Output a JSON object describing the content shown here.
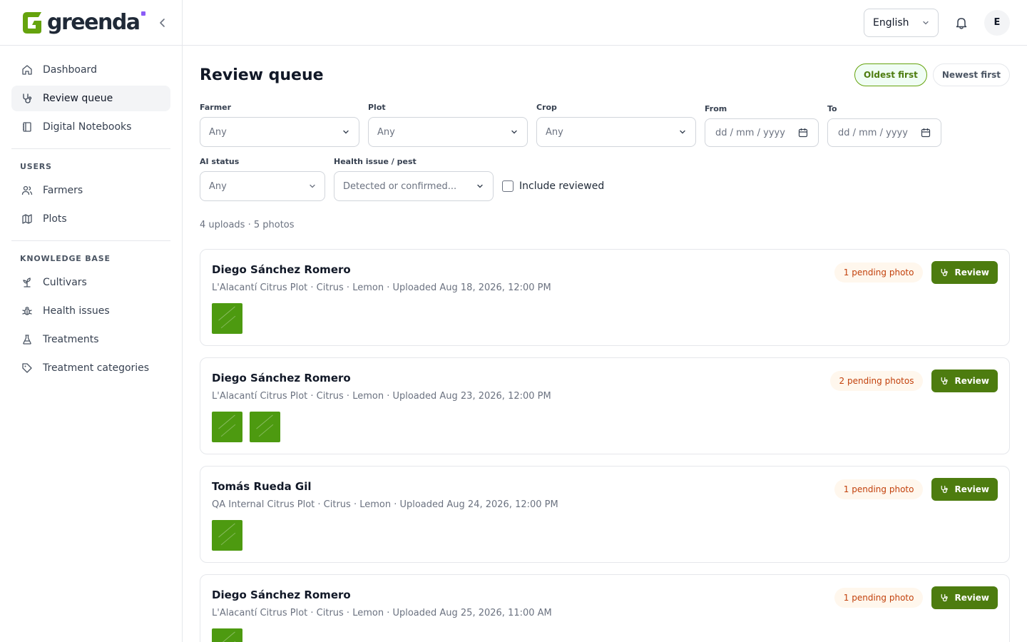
{
  "brand": {
    "name": "greenda",
    "accent": "#8b5cf6",
    "green": "#65a30d"
  },
  "sidebar": {
    "items": [
      {
        "label": "Dashboard",
        "icon": "home-icon"
      },
      {
        "label": "Review queue",
        "icon": "stethoscope-icon",
        "active": true
      },
      {
        "label": "Digital Notebooks",
        "icon": "notebook-icon"
      }
    ],
    "sections": [
      {
        "title": "USERS",
        "items": [
          {
            "label": "Farmers",
            "icon": "users-icon"
          },
          {
            "label": "Plots",
            "icon": "map-icon"
          }
        ]
      },
      {
        "title": "KNOWLEDGE BASE",
        "items": [
          {
            "label": "Cultivars",
            "icon": "sprout-icon"
          },
          {
            "label": "Health issues",
            "icon": "bug-icon"
          },
          {
            "label": "Treatments",
            "icon": "flask-icon"
          },
          {
            "label": "Treatment categories",
            "icon": "tag-icon"
          }
        ]
      }
    ]
  },
  "topbar": {
    "language": "English",
    "avatar_initial": "E"
  },
  "page": {
    "title": "Review queue",
    "sort": {
      "oldest": "Oldest first",
      "newest": "Newest first",
      "active": "oldest"
    },
    "filters": {
      "farmer": {
        "label": "Farmer",
        "value": "Any"
      },
      "plot": {
        "label": "Plot",
        "value": "Any"
      },
      "crop": {
        "label": "Crop",
        "value": "Any"
      },
      "from": {
        "label": "From",
        "value": "dd / mm / yyyy"
      },
      "to": {
        "label": "To",
        "value": "dd / mm / yyyy"
      },
      "ai_status": {
        "label": "AI status",
        "value": "Any"
      },
      "health_issue": {
        "label": "Health issue / pest",
        "value": "Detected or confirmed..."
      },
      "include_reviewed": {
        "label": "Include reviewed",
        "checked": false
      }
    },
    "summary": "4 uploads · 5 photos",
    "review_label": "Review",
    "uploads": [
      {
        "name": "Diego Sánchez Romero",
        "meta": "L'Alacantí Citrus Plot · Citrus · Lemon · Uploaded Aug 18, 2026, 12:00 PM",
        "pending": "1 pending photo",
        "photos": 1
      },
      {
        "name": "Diego Sánchez Romero",
        "meta": "L'Alacantí Citrus Plot · Citrus · Lemon · Uploaded Aug 23, 2026, 12:00 PM",
        "pending": "2 pending photos",
        "photos": 2
      },
      {
        "name": "Tomás Rueda Gil",
        "meta": "QA Internal Citrus Plot · Citrus · Lemon · Uploaded Aug 24, 2026, 12:00 PM",
        "pending": "1 pending photo",
        "photos": 1
      },
      {
        "name": "Diego Sánchez Romero",
        "meta": "L'Alacantí Citrus Plot · Citrus · Lemon · Uploaded Aug 25, 2026, 11:00 AM",
        "pending": "1 pending photo",
        "photos": 1
      }
    ]
  }
}
